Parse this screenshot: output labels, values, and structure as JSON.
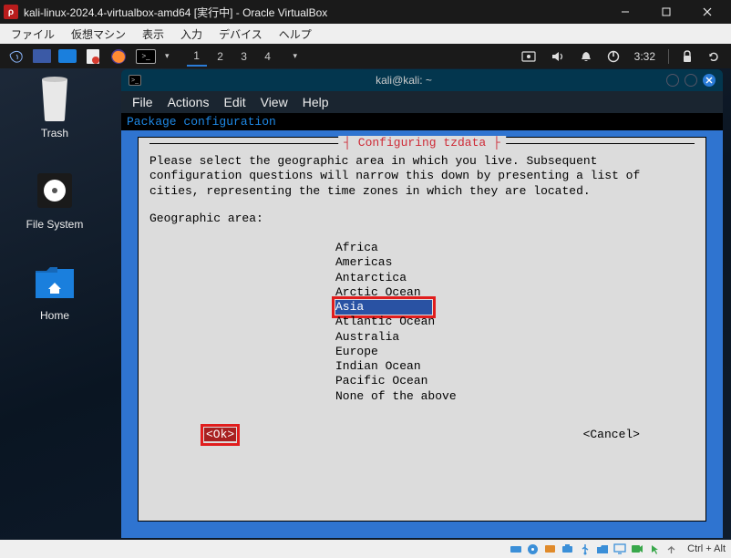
{
  "vbox": {
    "title": "kali-linux-2024.4-virtualbox-amd64 [実行中] - Oracle VirtualBox",
    "menus": [
      "ファイル",
      "仮想マシン",
      "表示",
      "入力",
      "デバイス",
      "ヘルプ"
    ],
    "hostkey": "Ctrl + Alt"
  },
  "panel": {
    "workspaces": [
      "1",
      "2",
      "3",
      "4"
    ],
    "active_workspace": 0,
    "clock": "3:32"
  },
  "desktop_icons": [
    {
      "label": "Trash"
    },
    {
      "label": "File System"
    },
    {
      "label": "Home"
    }
  ],
  "terminal": {
    "title": "kali@kali: ~",
    "menus": [
      "File",
      "Actions",
      "Edit",
      "View",
      "Help"
    ]
  },
  "tzdata": {
    "header": "Package configuration",
    "title": "Configuring tzdata",
    "text": "Please select the geographic area in which you live. Subsequent configuration questions will narrow this down by presenting a list of cities, representing the time zones in which they are located.",
    "prompt": "Geographic area:",
    "areas": [
      "Africa",
      "Americas",
      "Antarctica",
      "Arctic Ocean",
      "Asia",
      "Atlantic Ocean",
      "Australia",
      "Europe",
      "Indian Ocean",
      "Pacific Ocean",
      "None of the above"
    ],
    "selected_index": 4,
    "ok": "<Ok>",
    "cancel": "<Cancel>"
  }
}
